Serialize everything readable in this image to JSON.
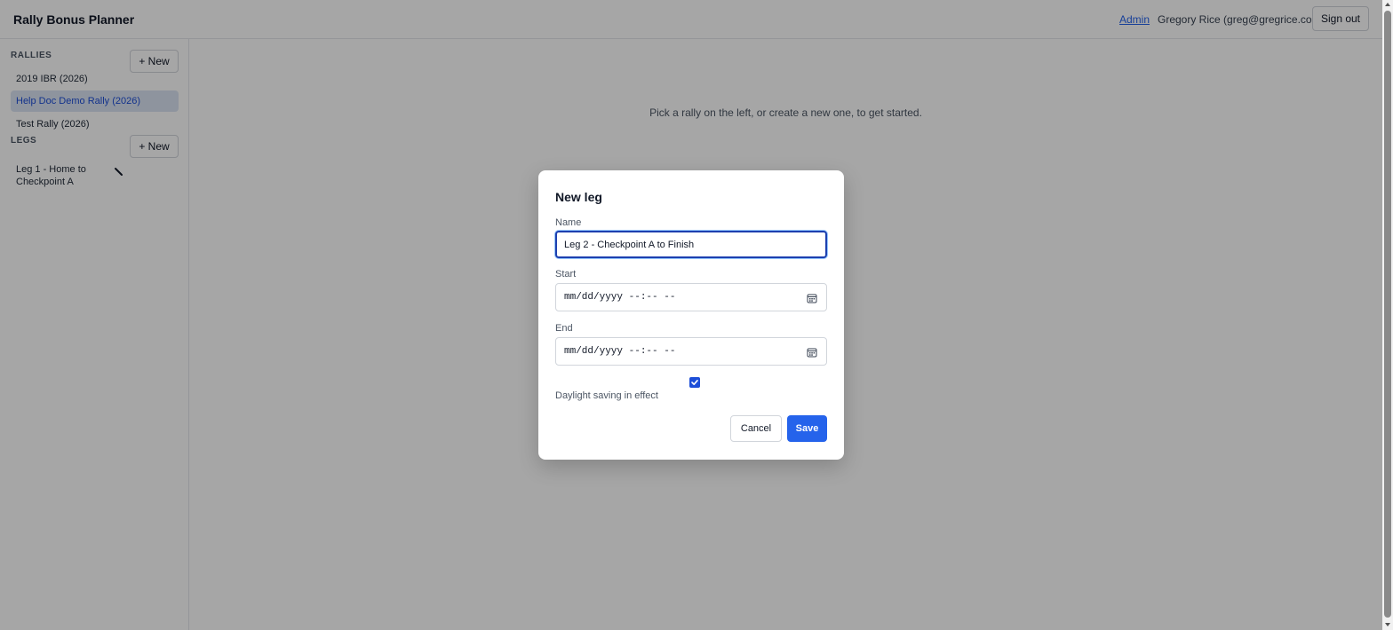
{
  "header": {
    "title": "Rally Bonus Planner",
    "admin_link": "Admin",
    "user": "Gregory Rice (greg@gregrice.com)",
    "sign_out": "Sign out"
  },
  "sidebar": {
    "rallies_title": "RALLIES",
    "rallies_new": "+ New",
    "rallies": [
      {
        "label": "2019 IBR (2026)",
        "active": false
      },
      {
        "label": "Help Doc Demo Rally (2026)",
        "active": true
      },
      {
        "label": "Test Rally (2026)",
        "active": false
      }
    ],
    "legs_title": "LEGS",
    "legs_new": "+ New",
    "legs": [
      {
        "label": "Leg 1 - Home to Checkpoint A",
        "icon": "pencil-icon"
      }
    ]
  },
  "main": {
    "empty_hint": "Pick a rally on the left, or create a new one, to get started."
  },
  "modal": {
    "title": "New leg",
    "name_label": "Name",
    "name_value": "Leg 2 - Checkpoint A to Finish",
    "start_label": "Start",
    "start_placeholder": "mm/dd/yyyy --:-- --",
    "end_label": "End",
    "end_placeholder": "mm/dd/yyyy --:-- --",
    "dst_checked": true,
    "dst_label": "Daylight saving in effect",
    "cancel": "Cancel",
    "save": "Save"
  },
  "colors": {
    "accent": "#2563eb",
    "active_item_bg": "#dbe4f3",
    "overlay": "rgba(0,0,0,0.35)"
  }
}
